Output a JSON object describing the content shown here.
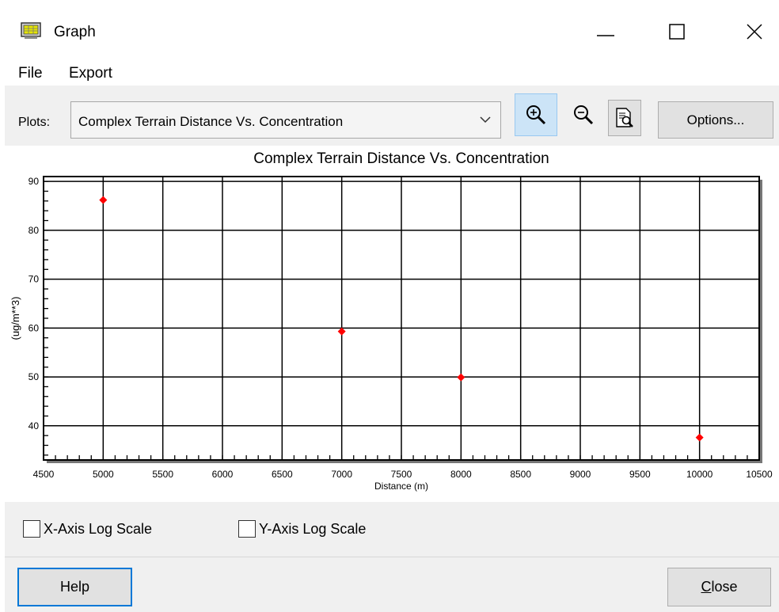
{
  "window": {
    "title": "Graph",
    "icon": "graph-app-icon"
  },
  "menu": {
    "file": "File",
    "export": "Export"
  },
  "toolbar": {
    "plots_label": "Plots:",
    "plots_selected": "Complex Terrain Distance Vs. Concentration",
    "options_label": "Options...",
    "zoom_in_icon": "zoom-in-icon",
    "zoom_out_icon": "zoom-out-icon",
    "print_preview_icon": "print-preview-icon"
  },
  "checkboxes": {
    "x_log": {
      "label": "X-Axis Log Scale",
      "checked": false
    },
    "y_log": {
      "label": "Y-Axis Log Scale",
      "checked": false
    }
  },
  "buttons": {
    "help": "Help",
    "close": "Close"
  },
  "colors": {
    "marker": "#ff0000",
    "selected_tool": "#cce4f7",
    "focus_border": "#0078d7"
  },
  "chart_data": {
    "type": "scatter",
    "title": "Complex Terrain Distance Vs. Concentration",
    "xlabel": "Distance (m)",
    "ylabel": "(ug/m**3)",
    "xlim": [
      4500,
      10500
    ],
    "ylim": [
      33,
      91
    ],
    "xticks": [
      4500,
      5000,
      5500,
      6000,
      6500,
      7000,
      7500,
      8000,
      8500,
      9000,
      9500,
      10000,
      10500
    ],
    "yticks": [
      40,
      50,
      60,
      70,
      80,
      90
    ],
    "grid": true,
    "legend": "none",
    "series": [
      {
        "x": [
          5000,
          7000,
          8000,
          10000
        ],
        "y": [
          86.2,
          59.3,
          49.9,
          37.6
        ]
      }
    ]
  }
}
